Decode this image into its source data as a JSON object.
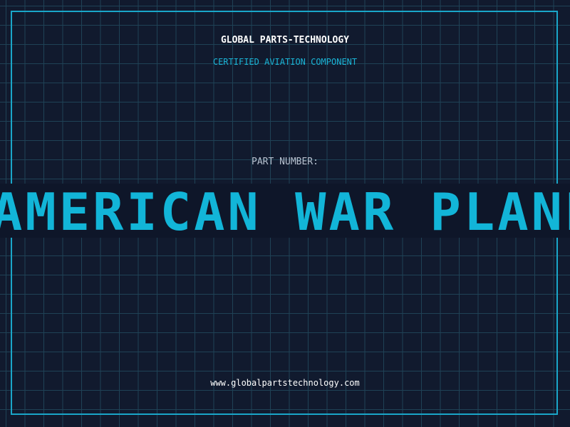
{
  "header": {
    "brand": "GLOBAL PARTS-TECHNOLOGY",
    "subtitle": "CERTIFIED AVIATION COMPONENT"
  },
  "part": {
    "label": "PART NUMBER:",
    "value": "AMERICAN WAR PLANES"
  },
  "footer": {
    "website": "www.globalpartstechnology.com"
  },
  "colors": {
    "background": "#111a2e",
    "grid": "#1f4256",
    "accent": "#1aa6c9",
    "part_text": "#12b5d8"
  }
}
